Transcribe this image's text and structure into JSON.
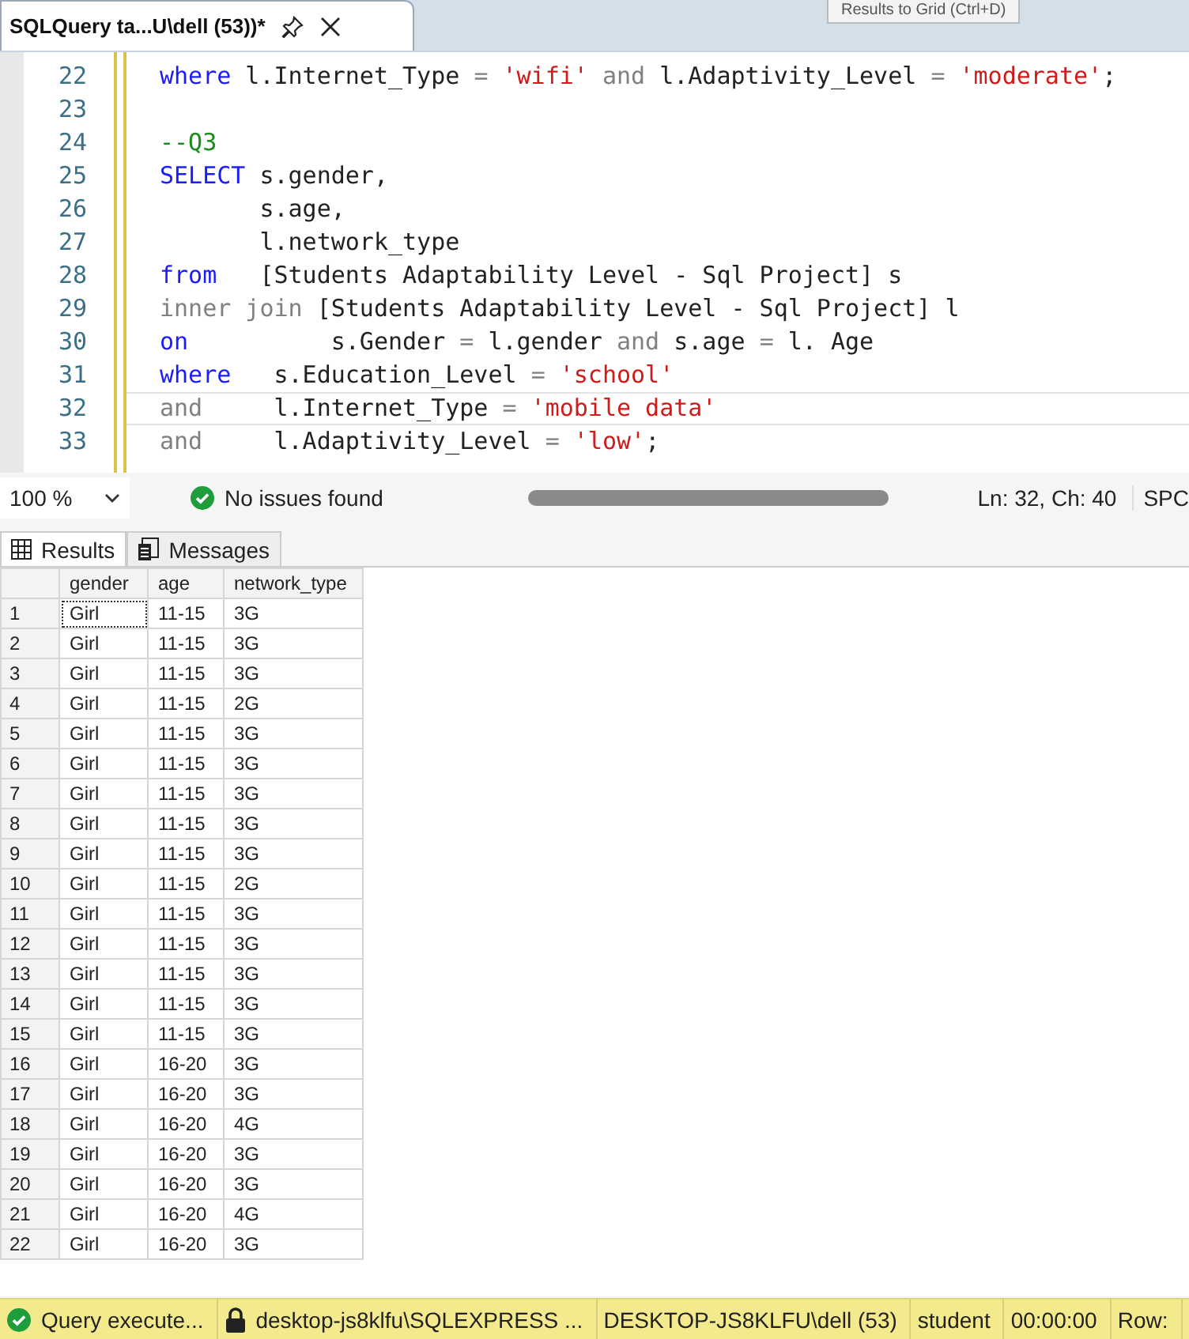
{
  "document_tab": {
    "title": "SQLQuery ta...U\\dell (53))*",
    "selected": true
  },
  "tooltip": {
    "text": "Results to Grid (Ctrl+D)"
  },
  "editor": {
    "lines": [
      {
        "number": "22",
        "current": false,
        "tokens": [
          {
            "kind": "keyword",
            "text": "where"
          },
          {
            "kind": "plain",
            "text": " l.Internet_Type "
          },
          {
            "kind": "operator",
            "text": "="
          },
          {
            "kind": "string",
            "text": " 'wifi'"
          },
          {
            "kind": "operator",
            "text": " and"
          },
          {
            "kind": "plain",
            "text": " l.Adaptivity_Level "
          },
          {
            "kind": "operator",
            "text": "="
          },
          {
            "kind": "string",
            "text": " 'moderate'"
          },
          {
            "kind": "plain",
            "text": ";"
          }
        ]
      },
      {
        "number": "23",
        "current": false
      },
      {
        "number": "24",
        "current": false,
        "tokens": [
          {
            "kind": "comment",
            "text": "--Q3"
          }
        ]
      },
      {
        "number": "25",
        "current": false,
        "tokens": [
          {
            "kind": "keyword",
            "text": "SELECT"
          },
          {
            "kind": "plain",
            "text": " s.gender,"
          }
        ]
      },
      {
        "number": "26",
        "current": false,
        "tokens": [
          {
            "kind": "plain",
            "text": "       s.age,"
          }
        ]
      },
      {
        "number": "27",
        "current": false,
        "tokens": [
          {
            "kind": "plain",
            "text": "       l.network_type"
          }
        ]
      },
      {
        "number": "28",
        "current": false,
        "tokens": [
          {
            "kind": "keyword",
            "text": "from"
          },
          {
            "kind": "plain",
            "text": "   [Students Adaptability Level - Sql Project] s"
          }
        ]
      },
      {
        "number": "29",
        "current": false,
        "tokens": [
          {
            "kind": "operator",
            "text": "inner join"
          },
          {
            "kind": "plain",
            "text": " [Students Adaptability Level - Sql Project] l"
          }
        ]
      },
      {
        "number": "30",
        "current": false,
        "tokens": [
          {
            "kind": "keyword",
            "text": "on"
          },
          {
            "kind": "plain",
            "text": "          s.Gender "
          },
          {
            "kind": "operator",
            "text": "="
          },
          {
            "kind": "plain",
            "text": " l.gender "
          },
          {
            "kind": "operator",
            "text": "and"
          },
          {
            "kind": "plain",
            "text": " s.age "
          },
          {
            "kind": "operator",
            "text": "="
          },
          {
            "kind": "plain",
            "text": " l. Age"
          }
        ]
      },
      {
        "number": "31",
        "current": false,
        "tokens": [
          {
            "kind": "keyword",
            "text": "where"
          },
          {
            "kind": "plain",
            "text": "   s.Education_Level "
          },
          {
            "kind": "operator",
            "text": "="
          },
          {
            "kind": "string",
            "text": " 'school'"
          }
        ]
      },
      {
        "number": "32",
        "current": true,
        "tokens": [
          {
            "kind": "operator",
            "text": "and"
          },
          {
            "kind": "plain",
            "text": "     l.Internet_Type "
          },
          {
            "kind": "operator",
            "text": "="
          },
          {
            "kind": "string",
            "text": " 'mobile data'"
          }
        ]
      },
      {
        "number": "33",
        "current": false,
        "tokens": [
          {
            "kind": "operator",
            "text": "and"
          },
          {
            "kind": "plain",
            "text": "     l.Adaptivity_Level "
          },
          {
            "kind": "operator",
            "text": "="
          },
          {
            "kind": "string",
            "text": " 'low'"
          },
          {
            "kind": "plain",
            "text": ";"
          }
        ]
      }
    ]
  },
  "editor_status": {
    "zoom": "100 %",
    "issues": "No issues found",
    "position": "Ln: 32, Ch: 40",
    "encoding": "SPC"
  },
  "result_tabs": [
    {
      "label": "Results",
      "selected": true
    },
    {
      "label": "Messages",
      "selected": false
    }
  ],
  "grid": {
    "columns": [
      "gender",
      "age",
      "network_type"
    ],
    "rows": [
      {
        "number": "1",
        "cells": [
          "Girl",
          "11-15",
          "3G"
        ],
        "focused": true
      },
      {
        "number": "2",
        "cells": [
          "Girl",
          "11-15",
          "3G"
        ],
        "focused": false
      },
      {
        "number": "3",
        "cells": [
          "Girl",
          "11-15",
          "3G"
        ],
        "focused": false
      },
      {
        "number": "4",
        "cells": [
          "Girl",
          "11-15",
          "2G"
        ],
        "focused": false
      },
      {
        "number": "5",
        "cells": [
          "Girl",
          "11-15",
          "3G"
        ],
        "focused": false
      },
      {
        "number": "6",
        "cells": [
          "Girl",
          "11-15",
          "3G"
        ],
        "focused": false
      },
      {
        "number": "7",
        "cells": [
          "Girl",
          "11-15",
          "3G"
        ],
        "focused": false
      },
      {
        "number": "8",
        "cells": [
          "Girl",
          "11-15",
          "3G"
        ],
        "focused": false
      },
      {
        "number": "9",
        "cells": [
          "Girl",
          "11-15",
          "3G"
        ],
        "focused": false
      },
      {
        "number": "10",
        "cells": [
          "Girl",
          "11-15",
          "2G"
        ],
        "focused": false
      },
      {
        "number": "11",
        "cells": [
          "Girl",
          "11-15",
          "3G"
        ],
        "focused": false
      },
      {
        "number": "12",
        "cells": [
          "Girl",
          "11-15",
          "3G"
        ],
        "focused": false
      },
      {
        "number": "13",
        "cells": [
          "Girl",
          "11-15",
          "3G"
        ],
        "focused": false
      },
      {
        "number": "14",
        "cells": [
          "Girl",
          "11-15",
          "3G"
        ],
        "focused": false
      },
      {
        "number": "15",
        "cells": [
          "Girl",
          "11-15",
          "3G"
        ],
        "focused": false
      },
      {
        "number": "16",
        "cells": [
          "Girl",
          "16-20",
          "3G"
        ],
        "focused": false
      },
      {
        "number": "17",
        "cells": [
          "Girl",
          "16-20",
          "3G"
        ],
        "focused": false
      },
      {
        "number": "18",
        "cells": [
          "Girl",
          "16-20",
          "4G"
        ],
        "focused": false
      },
      {
        "number": "19",
        "cells": [
          "Girl",
          "16-20",
          "3G"
        ],
        "focused": false
      },
      {
        "number": "20",
        "cells": [
          "Girl",
          "16-20",
          "3G"
        ],
        "focused": false
      },
      {
        "number": "21",
        "cells": [
          "Girl",
          "16-20",
          "4G"
        ],
        "focused": false
      },
      {
        "number": "22",
        "cells": [
          "Girl",
          "16-20",
          "3G"
        ],
        "focused": false
      }
    ]
  },
  "status_bar": {
    "items": [
      {
        "kind": "success",
        "text": "Query execute..."
      },
      {
        "kind": "server",
        "text": "desktop-js8klfu\\SQLEXPRESS ..."
      },
      {
        "kind": "plain",
        "text": "DESKTOP-JS8KLFU\\dell (53)"
      },
      {
        "kind": "plain",
        "text": "student"
      },
      {
        "kind": "plain",
        "text": "00:00:00"
      },
      {
        "kind": "plain",
        "text": "Row:"
      }
    ]
  }
}
